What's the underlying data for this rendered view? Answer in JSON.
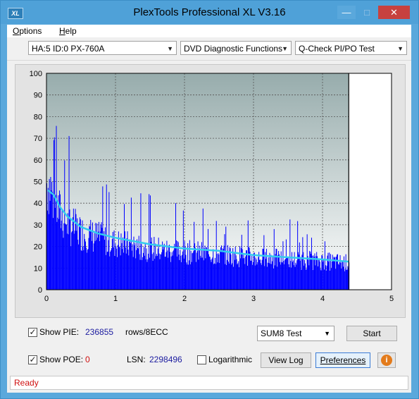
{
  "window": {
    "title": "PlexTools Professional XL V3.16",
    "icon_text": "XL"
  },
  "menu": {
    "items": [
      "Options",
      "Help"
    ]
  },
  "toolbar": {
    "drive": "HA:5 ID:0  PX-760A",
    "function": "DVD Diagnostic Functions",
    "test": "Q-Check PI/PO Test"
  },
  "chart_data": {
    "type": "bar",
    "x_ticks": [
      "0",
      "1",
      "2",
      "3",
      "4",
      "5"
    ],
    "y_ticks": [
      "0",
      "10",
      "20",
      "30",
      "40",
      "50",
      "60",
      "70",
      "80",
      "90",
      "100"
    ],
    "xlim": [
      0,
      5
    ],
    "ylim": [
      0,
      100
    ],
    "end_marker_x": 4.38,
    "series": [
      {
        "kind": "bars",
        "color": "#0000ff",
        "envelope": [
          [
            0.0,
            60
          ],
          [
            0.05,
            58
          ],
          [
            0.1,
            50
          ],
          [
            0.2,
            42
          ],
          [
            0.3,
            37
          ],
          [
            0.5,
            32
          ],
          [
            0.75,
            29
          ],
          [
            1.0,
            26
          ],
          [
            1.5,
            23
          ],
          [
            2.0,
            21
          ],
          [
            2.5,
            20
          ],
          [
            3.0,
            18
          ],
          [
            3.5,
            17
          ],
          [
            4.0,
            16
          ],
          [
            4.38,
            15
          ]
        ]
      },
      {
        "kind": "line",
        "color": "#33ccee",
        "points": [
          [
            0.02,
            46
          ],
          [
            0.1,
            44
          ],
          [
            0.2,
            38
          ],
          [
            0.3,
            34
          ],
          [
            0.5,
            29
          ],
          [
            0.75,
            26
          ],
          [
            1.0,
            24
          ],
          [
            1.5,
            21
          ],
          [
            2.0,
            19
          ],
          [
            2.5,
            18
          ],
          [
            3.0,
            16
          ],
          [
            3.5,
            15
          ],
          [
            4.0,
            14
          ],
          [
            4.38,
            13
          ]
        ]
      }
    ],
    "grid": true
  },
  "controls": {
    "show_pie_label": "Show PIE:",
    "pie_value": "236855",
    "pie_unit": "rows/8ECC",
    "show_poe_label": "Show POE:",
    "poe_value": "0",
    "lsn_label": "LSN:",
    "lsn_value": "2298496",
    "logarithmic_label": "Logarithmic",
    "test_mode": "SUM8 Test",
    "start_label": "Start",
    "view_log_label": "View Log",
    "preferences_label": "Preferences",
    "show_pie_checked": true,
    "show_poe_checked": true,
    "logarithmic_checked": false
  },
  "status": {
    "text": "Ready"
  }
}
